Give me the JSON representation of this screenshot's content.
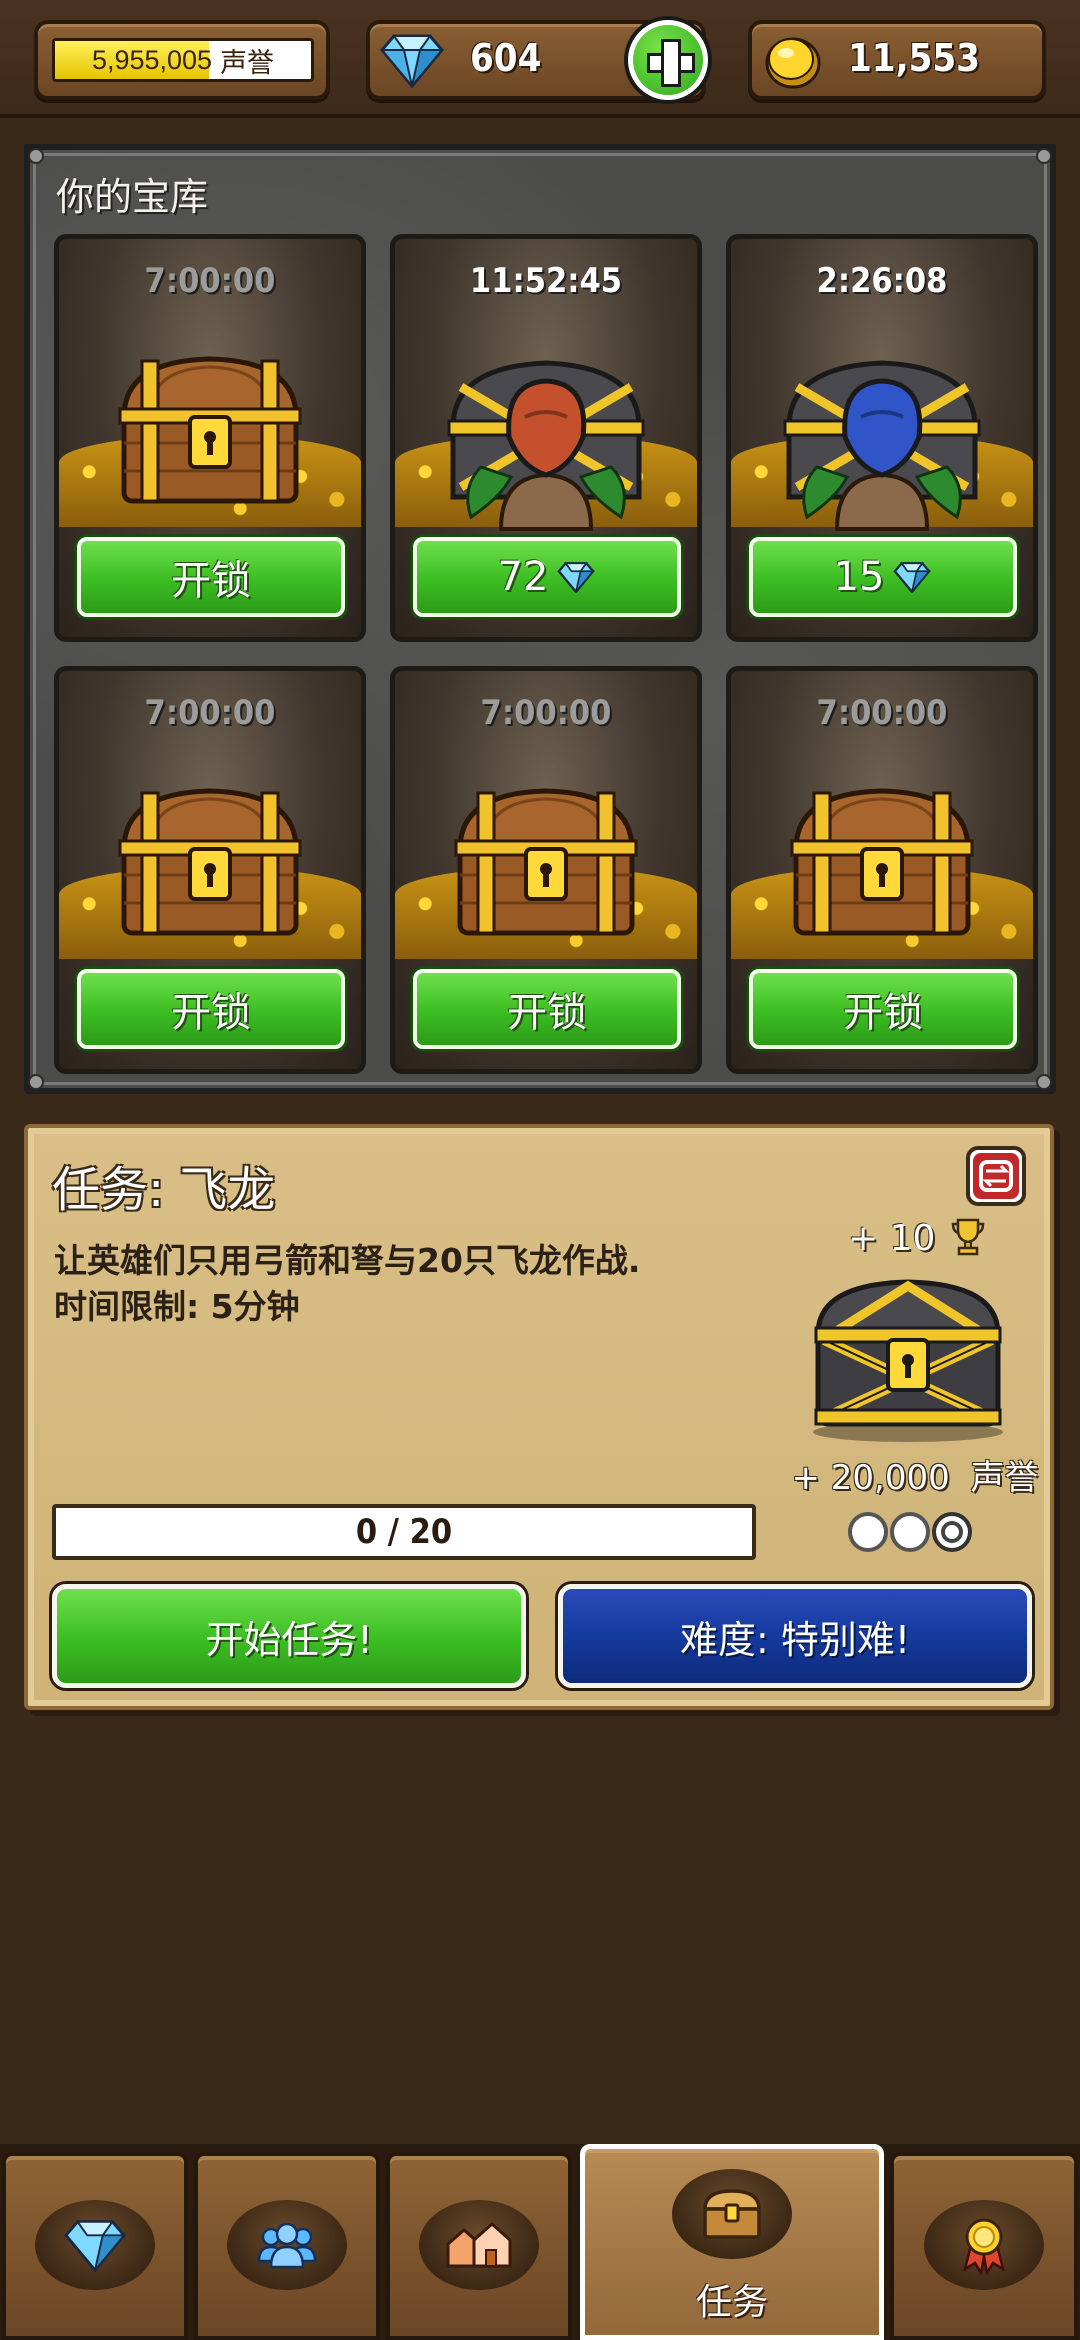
{
  "topbar": {
    "reputation": {
      "value": "5,955,005",
      "unit": "声誉",
      "fill": 0.6
    },
    "gems": "604",
    "gold": "11,553"
  },
  "vault": {
    "title": "你的宝库",
    "slots": [
      {
        "timer": "7:00:00",
        "active": false,
        "chest": "wood",
        "button": "开锁",
        "cost": null
      },
      {
        "timer": "11:52:45",
        "active": true,
        "chest": "gold-idol-red",
        "button": "72",
        "cost": "gem"
      },
      {
        "timer": "2:26:08",
        "active": true,
        "chest": "gold-idol-blue",
        "button": "15",
        "cost": "gem"
      },
      {
        "timer": "7:00:00",
        "active": false,
        "chest": "wood",
        "button": "开锁",
        "cost": null
      },
      {
        "timer": "7:00:00",
        "active": false,
        "chest": "wood",
        "button": "开锁",
        "cost": null
      },
      {
        "timer": "7:00:00",
        "active": false,
        "chest": "wood",
        "button": "开锁",
        "cost": null
      }
    ]
  },
  "quest": {
    "title": "任务: 飞龙",
    "desc_line1": "让英雄们只用弓箭和弩与20只飞龙作战.",
    "desc_line2": "时间限制: 5分钟",
    "reward_trophy": "+ 10",
    "reward_rep_value": "+ 20,000",
    "reward_rep_unit": "声誉",
    "progress": "0 / 20",
    "progress_fraction": 0,
    "stars": {
      "total": 3,
      "earned": 0
    },
    "start_label": "开始任务!",
    "difficulty_label": "难度: 特别难!"
  },
  "nav": {
    "tabs": [
      {
        "name": "gems",
        "icon": "gem-icon",
        "label": ""
      },
      {
        "name": "heroes",
        "icon": "heroes-icon",
        "label": ""
      },
      {
        "name": "town",
        "icon": "town-icon",
        "label": ""
      },
      {
        "name": "quests",
        "icon": "chest-icon",
        "label": "任务",
        "active": true
      },
      {
        "name": "achievements",
        "icon": "medal-icon",
        "label": ""
      }
    ]
  },
  "colors": {
    "button_green": "#3bbd22",
    "button_blue": "#153a9e",
    "parchment": "#d9bf87",
    "wood_dark": "#3a2819"
  }
}
